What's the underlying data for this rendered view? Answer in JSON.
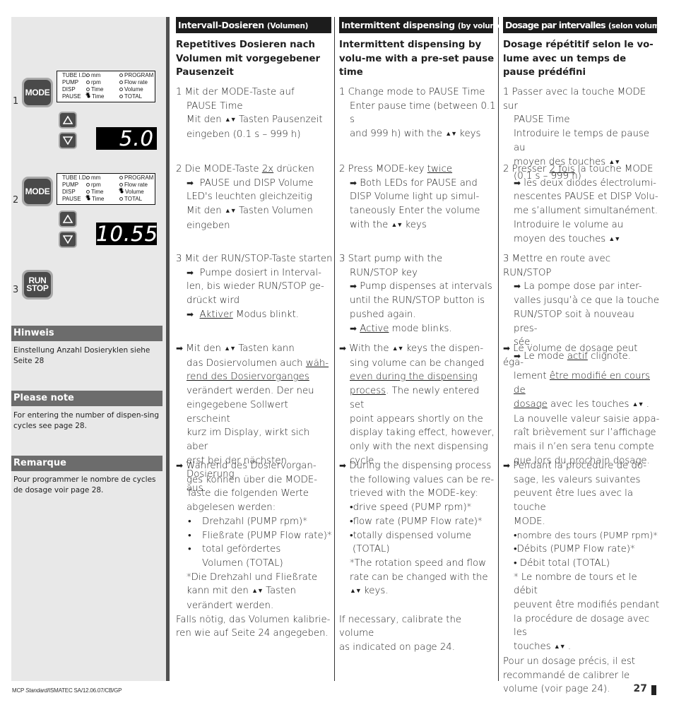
{
  "left_panel": {
    "figures": [
      {
        "step": "1",
        "key_label": "MODE",
        "led_panel": {
          "rows": [
            {
              "group": "TUBE I.D.",
              "mid": "mm",
              "right": "PROGRAM",
              "mid_on": false,
              "right_on": false
            },
            {
              "group": "PUMP",
              "mid": "rpm",
              "right": "Flow rate",
              "mid_on": false,
              "right_on": false
            },
            {
              "group": "DISP",
              "mid": "Time",
              "right": "Volume",
              "mid_on": false,
              "right_on": false
            },
            {
              "group": "PAUSE",
              "mid": "Time",
              "right": "TOTAL",
              "mid_on": true,
              "right_on": false
            }
          ]
        },
        "display_value": "5.0"
      },
      {
        "step": "2",
        "key_label": "MODE",
        "led_panel": {
          "rows": [
            {
              "group": "TUBE I.D.",
              "mid": "mm",
              "right": "PROGRAM",
              "mid_on": false,
              "right_on": false
            },
            {
              "group": "PUMP",
              "mid": "rpm",
              "right": "Flow rate",
              "mid_on": false,
              "right_on": false
            },
            {
              "group": "DISP",
              "mid": "Time",
              "right": "Volume",
              "mid_on": false,
              "right_on": true
            },
            {
              "group": "PAUSE",
              "mid": "Time",
              "right": "TOTAL",
              "mid_on": true,
              "right_on": false
            }
          ]
        },
        "display_value": "10.55"
      },
      {
        "step": "3",
        "key_label_line1": "RUN",
        "key_label_line2": "STOP"
      }
    ],
    "notes": [
      {
        "title": "Hinweis",
        "body": "Einstellung Anzahl Dosieryklen siehe Seite 28"
      },
      {
        "title": "Please note",
        "body": "For entering the number of dispen-sing cycles see page 28."
      },
      {
        "title": "Remarque",
        "body": "Pour programmer le nombre de cycles de dosage voir page 28."
      }
    ]
  },
  "columns": {
    "de": {
      "header": "Intervall-Dosieren",
      "header_small": "(Volumen)",
      "subtitle": "Repetitives Dosieren nach Volumen mit vorgegebener Pausenzeit",
      "s1_a": "1 Mit der MODE-Taste auf",
      "s1_b": "PAUSE Time",
      "s1_c1": "Mit den ",
      "s1_c2": " Tasten Pausenzeit",
      "s1_d": "eingeben (0.1 s – 999 h)",
      "s2_a1": "2 Die MODE-Taste ",
      "s2_a_ul": "2x",
      "s2_a2": " drücken",
      "s2_b": "PAUSE und DISP Volume",
      "s2_c": "LED's leuchten gleichzeitig",
      "s2_d1": "Mit den ",
      "s2_d2": " Tasten Volumen",
      "s2_e": "eingeben",
      "s3_a": "3 Mit der RUN/STOP-Taste starten",
      "s3_b": "Pumpe dosiert in Interval-",
      "s3_c": "len, bis wieder RUN/STOP ge-",
      "s3_d": "drückt wird",
      "s3_e_ul": "Aktiver",
      "s3_e2": " Modus blinkt.",
      "p4_a1": " Mit den ",
      "p4_a2": " Tasten kann",
      "p4_b1": "das Dosiervolumen auch ",
      "p4_b_ul": "wäh-",
      "p4_c_ul": "rend des Dosiervorganges",
      "p4_d": "verändert werden. Der neu",
      "p4_e": "eingegebene Sollwert erscheint",
      "p4_f": "kurz im Display,  wirkt sich aber",
      "p4_g": "erst bei der nächsten Dosierung",
      "p4_h": "aus.",
      "p5_a": " Während des Dosiervorgan-",
      "p5_b": "ges können über die MODE-",
      "p5_c": "Taste die folgenden Werte",
      "p5_d": "abgelesen werden:",
      "bullets": [
        "Drehzahl (PUMP rpm)*",
        "Fließrate (PUMP Flow rate)*",
        "total gefördertes",
        "Volumen (TOTAL)"
      ],
      "p5_fn1": "*Die Drehzahl und Fließrate",
      "p5_fn2a": "kann mit den ",
      "p5_fn2b": " Tasten",
      "p5_fn3": "verändert werden.",
      "p6_a": "Falls nötig, das Volumen kalibrie-",
      "p6_b": "ren wie auf Seite 24 angegeben."
    },
    "en": {
      "header": "Intermittent dispensing",
      "header_small": "(by volume)",
      "subtitle": "Intermittent dispensing by volu-me with a pre-set pause time",
      "s1_a": "1 Change mode to PAUSE Time",
      "s1_b": "Enter pause time (between 0.1 s",
      "s1_c1": "and 999 h) with the ",
      "s1_c2": " keys",
      "s2_a1": "2 Press MODE-key ",
      "s2_a_ul": "twice",
      "s2_b": " Both LEDs for PAUSE and",
      "s2_c": "DISP Volume light up simul-",
      "s2_d": "taneously Enter the volume",
      "s2_e1": "with the ",
      "s2_e2": " keys",
      "s3_a": "3 Start pump with the",
      "s3_b": "RUN/STOP key",
      "s3_c": " Pump dispenses at intervals",
      "s3_d": "until the RUN/STOP button is",
      "s3_e": "pushed again.",
      "s3_f_ul": "Active",
      "s3_f2": " mode blinks.",
      "p4_a1": " With the ",
      "p4_a2": " keys the dispen-",
      "p4_b": "sing volume can be changed",
      "p4_c_ul": "even during the dispensing ",
      "p4_d_ul": "process",
      "p4_d2": ". The newly entered set",
      "p4_e": "point appears shortly on the",
      "p4_f": "display taking effect, however,",
      "p4_g": "only with the next dispensing",
      "p4_h": "cycle.",
      "p5_a": " During the dispensing process",
      "p5_b": "the following values can be re-",
      "p5_c": "trieved with the MODE-key:",
      "bullets": [
        "drive speed (PUMP rpm)*",
        "flow rate (PUMP Flow rate)*",
        "totally dispensed volume",
        "(TOTAL)"
      ],
      "p5_fn1": "*The rotation speed and flow",
      "p5_fn2": "rate can be changed with the",
      "p5_fn3": " keys.",
      "p6_a": "If necessary, calibrate the volume",
      "p6_b": "as indicated on page 24."
    },
    "fr": {
      "header": "Dosage par intervalles",
      "header_small": "(selon volume)",
      "subtitle": "Dosage répétitif selon le vo-lume avec un temps de pause prédéfini",
      "s1_a": "1 Passer avec la touche MODE sur",
      "s1_b": "PAUSE Time",
      "s1_c": "Introduire le temps de pause au",
      "s1_d": "moyen des touches ",
      "s1_e": "(0.1 s – 999 h)",
      "s2_a1": "2 Presser ",
      "s2_a_ul": "2 fois",
      "s2_a2": " la touche MODE",
      "s2_b": " les deux diodes électrolumi-",
      "s2_c": "nescentes PAUSE et DISP Volu-",
      "s2_d": "me s’allument simultanément.",
      "s2_e": "Introduire le volume au",
      "s2_f": "moyen des touches ",
      "s3_a": "3 Mettre en route avec RUN/STOP",
      "s3_b": " La pompe dose par inter-",
      "s3_c": "valles jusqu’à ce que la touche",
      "s3_d": "RUN/STOP soit à nouveau  pres-",
      "s3_e": "sée.",
      "s3_f1": " Le mode ",
      "s3_f_ul": "actif",
      "s3_f2": " clignote.",
      "p4_a": " Le volume de dosage peut éga-",
      "p4_b1": "lement ",
      "p4_b_ul": "être modifié en cours de",
      "p4_c_ul": "dosage",
      "p4_c2": " avec les touches ",
      "p4_c3": " .",
      "p4_d": "La nouvelle valeur saisie appa-",
      "p4_e": "raît brièvement sur l’affichage",
      "p4_f": "mais il n’en sera tenu compte",
      "p4_g": "que lors du prochain dosage.",
      "p5_a": " Pendant la procédure de  do-",
      "p5_b": "sage, les valeurs suivantes",
      "p5_c": "peuvent être lues avec la touche",
      "p5_d": "MODE.",
      "bullets": [
        "nombre des tours (PUMP rpm)*",
        "Débits (PUMP Flow rate)*",
        "Débit total (TOTAL)"
      ],
      "p5_fn1": "* Le nombre de tours et le débit",
      "p5_fn2": "peuvent être modifiés pendant",
      "p5_fn3": "la procédure de dosage avec les",
      "p5_fn4a": "touches ",
      "p5_fn4b": " .",
      "p6_a": "Pour un dosage précis, il est",
      "p6_b": "recommandé de calibrer le",
      "p6_c": "volume (voir page 24)."
    }
  },
  "glyphs": {
    "arrow": "➡",
    "updown": "▲▼",
    "bullet": "•"
  },
  "footer": {
    "doc_ref_prefix": "MCP ",
    "doc_ref_italic": "Standard",
    "doc_ref_suffix": "/ISMATEC SA/12.06.07/CB/GP",
    "page_number": "27"
  }
}
